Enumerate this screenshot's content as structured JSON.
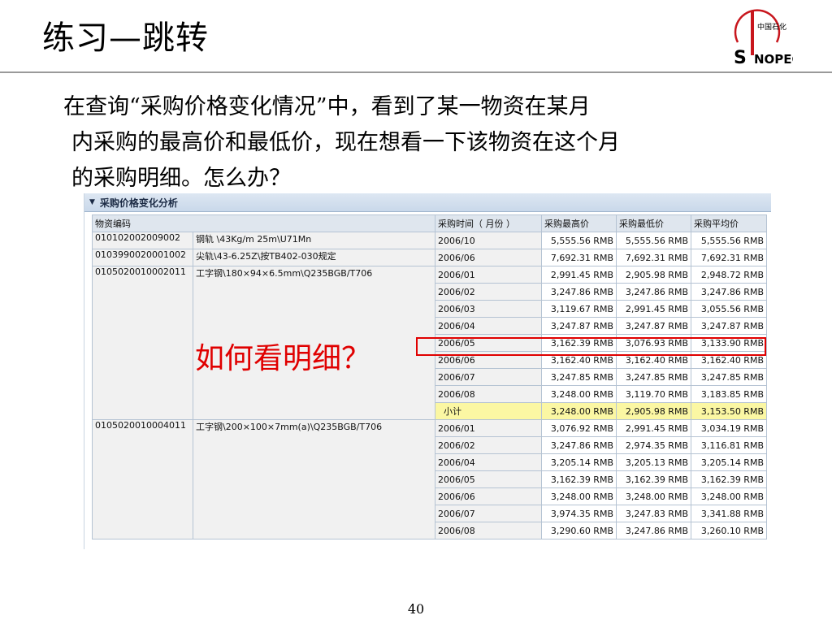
{
  "slide": {
    "title": "练习—跳转",
    "body_line1": "在查询“采购价格变化情况”中，看到了某一物资在某月",
    "body_line2": "内采购的最高价和最低价，现在想看一下该物资在这个月",
    "body_line3": "的采购明细。怎么办？",
    "annotation": "如何看明细？",
    "page_number": "40",
    "annotation_color": "#e00000"
  },
  "logo": {
    "icon": "sinopec-logo-icon",
    "text": "SINOPEC",
    "cn_text": "中国石化"
  },
  "report": {
    "panel_title": "采购价格变化分析",
    "columns": [
      "物资编码",
      "采购时间（ 月份 ）",
      "采购最高价",
      "采购最低价",
      "采购平均价"
    ],
    "groups": [
      {
        "code": "010102002009002",
        "desc": "钢轨  \\43Kg/m 25m\\U71Mn",
        "rows": [
          {
            "month": "2006/10",
            "max": "5,555.56 RMB",
            "min": "5,555.56 RMB",
            "avg": "5,555.56 RMB"
          }
        ]
      },
      {
        "code": "0103990020001002",
        "desc": "尖轨\\43-6.25Z\\按TB402-030规定",
        "rows": [
          {
            "month": "2006/06",
            "max": "7,692.31 RMB",
            "min": "7,692.31 RMB",
            "avg": "7,692.31 RMB"
          }
        ]
      },
      {
        "code": "0105020010002011",
        "desc": "工字钢\\180×94×6.5mm\\Q235BGB/T706",
        "rows": [
          {
            "month": "2006/01",
            "max": "2,991.45 RMB",
            "min": "2,905.98 RMB",
            "avg": "2,948.72 RMB"
          },
          {
            "month": "2006/02",
            "max": "3,247.86 RMB",
            "min": "3,247.86 RMB",
            "avg": "3,247.86 RMB"
          },
          {
            "month": "2006/03",
            "max": "3,119.67 RMB",
            "min": "2,991.45 RMB",
            "avg": "3,055.56 RMB"
          },
          {
            "month": "2006/04",
            "max": "3,247.87 RMB",
            "min": "3,247.87 RMB",
            "avg": "3,247.87 RMB"
          },
          {
            "month": "2006/05",
            "max": "3,162.39 RMB",
            "min": "3,076.93 RMB",
            "avg": "3,133.90 RMB"
          },
          {
            "month": "2006/06",
            "max": "3,162.40 RMB",
            "min": "3,162.40 RMB",
            "avg": "3,162.40 RMB"
          },
          {
            "month": "2006/07",
            "max": "3,247.85 RMB",
            "min": "3,247.85 RMB",
            "avg": "3,247.85 RMB"
          },
          {
            "month": "2006/08",
            "max": "3,248.00 RMB",
            "min": "3,119.70 RMB",
            "avg": "3,183.85 RMB"
          },
          {
            "month": "小计",
            "max": "3,248.00 RMB",
            "min": "2,905.98 RMB",
            "avg": "3,153.50 RMB",
            "subtotal": true
          }
        ]
      },
      {
        "code": "0105020010004011",
        "desc": "工字钢\\200×100×7mm(a)\\Q235BGB/T706",
        "rows": [
          {
            "month": "2006/01",
            "max": "3,076.92 RMB",
            "min": "2,991.45 RMB",
            "avg": "3,034.19 RMB"
          },
          {
            "month": "2006/02",
            "max": "3,247.86 RMB",
            "min": "2,974.35 RMB",
            "avg": "3,116.81 RMB"
          },
          {
            "month": "2006/04",
            "max": "3,205.14 RMB",
            "min": "3,205.13 RMB",
            "avg": "3,205.14 RMB"
          },
          {
            "month": "2006/05",
            "max": "3,162.39 RMB",
            "min": "3,162.39 RMB",
            "avg": "3,162.39 RMB"
          },
          {
            "month": "2006/06",
            "max": "3,248.00 RMB",
            "min": "3,248.00 RMB",
            "avg": "3,248.00 RMB"
          },
          {
            "month": "2006/07",
            "max": "3,974.35 RMB",
            "min": "3,247.83 RMB",
            "avg": "3,341.88 RMB"
          },
          {
            "month": "2006/08",
            "max": "3,290.60 RMB",
            "min": "3,247.86 RMB",
            "avg": "3,260.10 RMB"
          }
        ]
      }
    ]
  }
}
